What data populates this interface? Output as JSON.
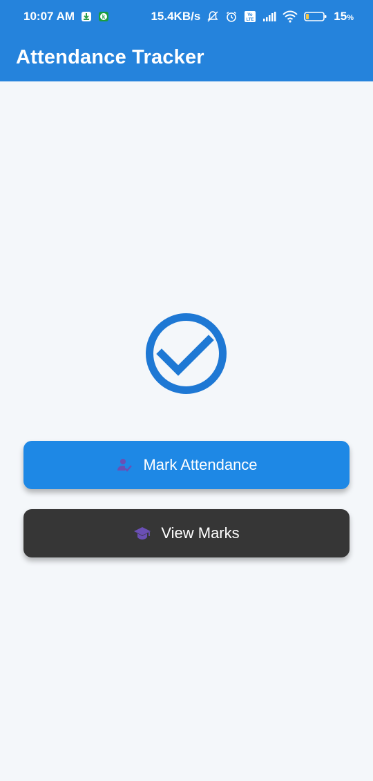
{
  "status_bar": {
    "time": "10:07 AM",
    "speed": "15.4KB/s",
    "battery": "15",
    "battery_unit": "%",
    "battery_level": 0.15,
    "icons": [
      "download-icon",
      "k-app-icon",
      "mute-bell-icon",
      "alarm-icon",
      "volte-icon",
      "signal-icon",
      "wifi-icon",
      "battery-icon"
    ]
  },
  "app_bar": {
    "title": "Attendance Tracker"
  },
  "hero": {
    "icon": "check-circle-icon",
    "color": "#1e78d4"
  },
  "buttons": {
    "mark_attendance": {
      "label": "Mark Attendance",
      "icon": "person-check-icon",
      "color": "#1e88e5"
    },
    "view_marks": {
      "label": "View Marks",
      "icon": "graduation-cap-icon",
      "color": "#363636"
    }
  },
  "colors": {
    "primary": "#2583dc",
    "background": "#f4f7fa",
    "icon_accent": "#6a4fb5"
  }
}
